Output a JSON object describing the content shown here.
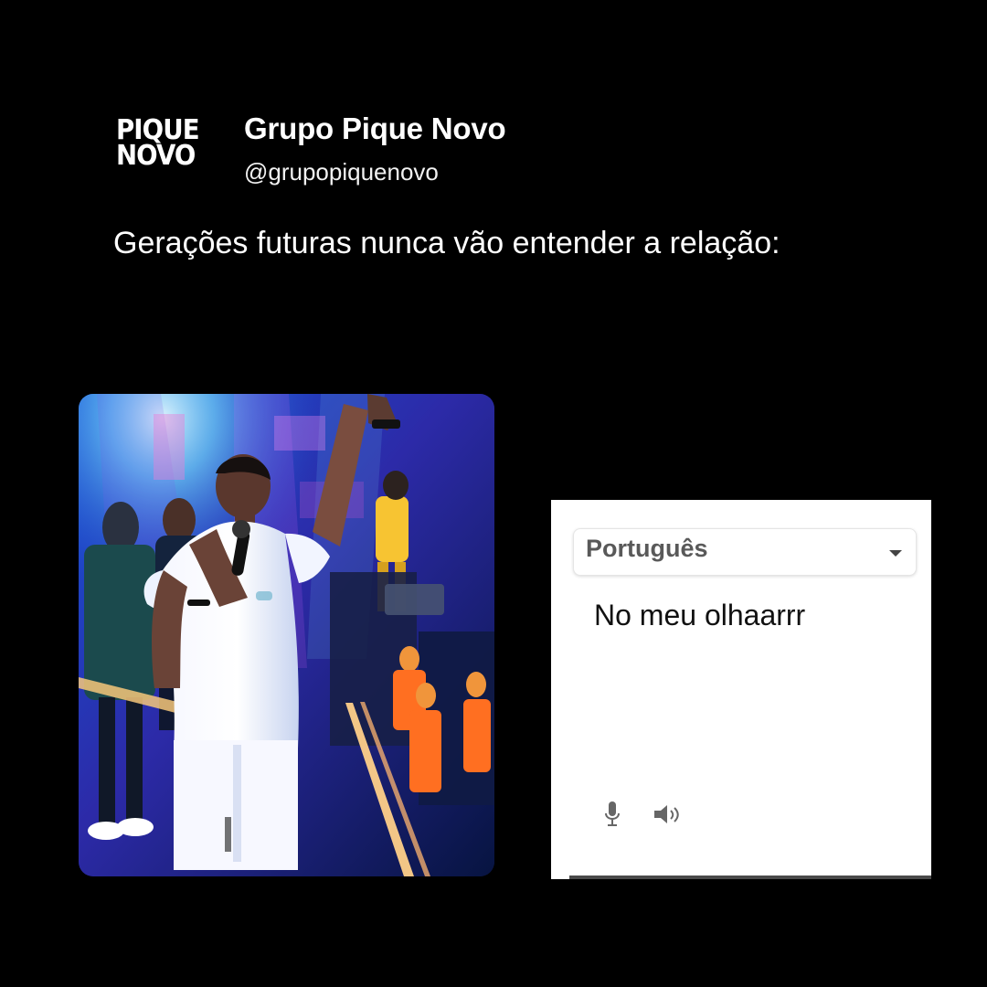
{
  "account": {
    "logo_line_1": "PIQUE",
    "logo_line_2": "NOVO",
    "name": "Grupo Pique Novo",
    "handle": "@grupopiquenovo"
  },
  "post": {
    "text": "Gerações futuras nunca vão entender a relação:"
  },
  "translator": {
    "language": "Português",
    "text": "No meu olhaarrr"
  },
  "icons": {
    "dropdown": "chevron-down-icon",
    "microphone": "microphone-icon",
    "speaker": "speaker-icon"
  },
  "colors": {
    "background": "#000000",
    "text": "#ffffff",
    "card": "#ffffff",
    "language_text": "#595959"
  }
}
